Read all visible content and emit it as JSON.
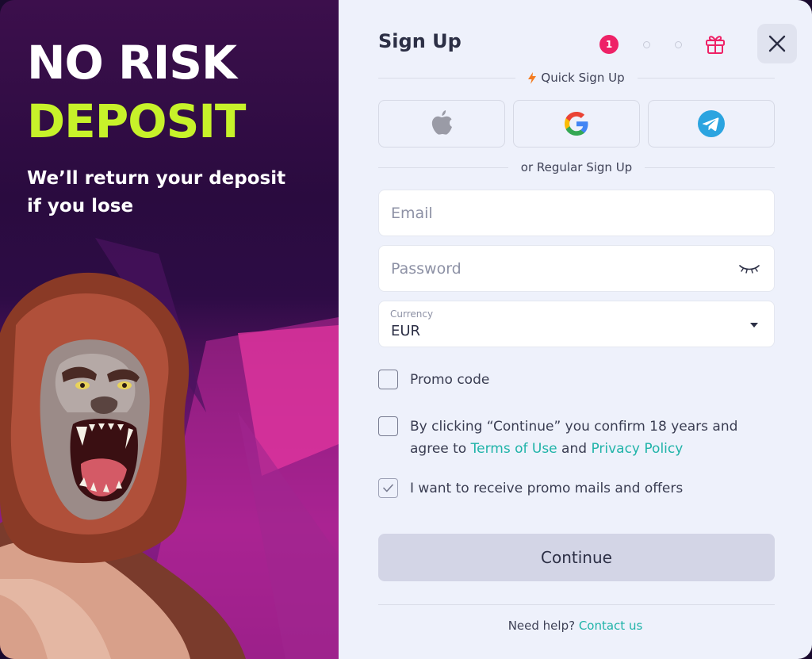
{
  "promo": {
    "title_line1": "NO RISK",
    "title_line2": "DEPOSIT",
    "subtitle_line1": "We’ll return your deposit",
    "subtitle_line2": "if you lose"
  },
  "form": {
    "title": "Sign Up",
    "stepper": {
      "current_step": "1",
      "total_steps": 3
    },
    "quick_signup_label": "Quick Sign Up",
    "regular_signup_label": "or Regular Sign Up",
    "social_buttons": [
      "apple-icon",
      "google-icon",
      "telegram-icon"
    ],
    "email": {
      "placeholder": "Email",
      "value": ""
    },
    "password": {
      "placeholder": "Password",
      "value": ""
    },
    "currency": {
      "label": "Currency",
      "value": "EUR"
    },
    "promo_code": {
      "label": "Promo code",
      "checked": false
    },
    "terms": {
      "checked": false,
      "text_before": "By clicking “Continue” you confirm 18 years and agree to ",
      "terms_link": "Terms of Use",
      "and": " and ",
      "privacy_link": "Privacy Policy"
    },
    "promo_mails": {
      "label": "I want to receive promo mails and offers",
      "checked": true
    },
    "continue_label": "Continue",
    "help_text": "Need help?",
    "contact_link": "Contact us"
  },
  "colors": {
    "accent_green": "#c7f22a",
    "step_active": "#ee2267",
    "link": "#1fb3a8",
    "quick_icon": "#f47b20"
  }
}
